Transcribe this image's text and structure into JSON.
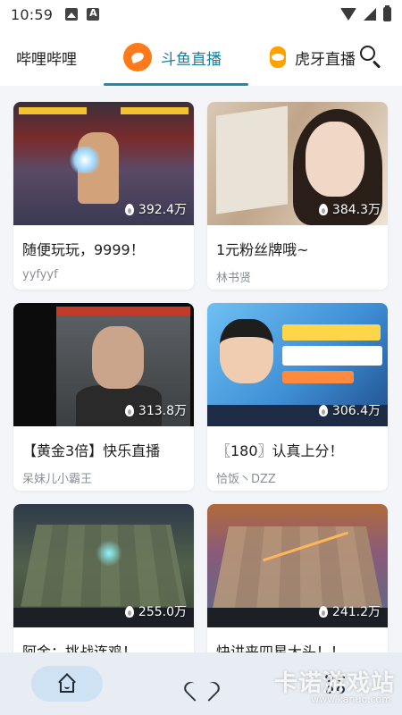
{
  "status_bar": {
    "time": "10:59"
  },
  "tabs": [
    {
      "label": "哔哩哔哩",
      "active": false
    },
    {
      "label": "斗鱼直播",
      "active": true
    },
    {
      "label": "虎牙直播",
      "active": false
    }
  ],
  "accent_color": "#1e8aa8",
  "streams": [
    {
      "title": "随便玩玩，9999！",
      "author": "yyfyyf",
      "viewers": "392.4万"
    },
    {
      "title": "1元粉丝牌哦~",
      "author": "林书贤",
      "viewers": "384.3万"
    },
    {
      "title": "【黄金3倍】快乐直播",
      "author": "呆妹儿小霸王",
      "viewers": "313.8万"
    },
    {
      "title": "〖180〗认真上分！",
      "author": "恰饭丶DZZ",
      "viewers": "306.4万"
    },
    {
      "title": "阿金：挑战连鸡！",
      "author": "",
      "viewers": "255.0万"
    },
    {
      "title": "快讲来四星大头！！",
      "author": "",
      "viewers": "241.2万"
    }
  ],
  "bottom_nav": [
    {
      "icon": "home-icon",
      "active": true
    },
    {
      "icon": "heart-icon",
      "active": false
    },
    {
      "icon": "category-grid-icon",
      "active": false
    }
  ],
  "watermark": {
    "text": "卡诺游戏站",
    "url": "www.kanuo.com"
  }
}
